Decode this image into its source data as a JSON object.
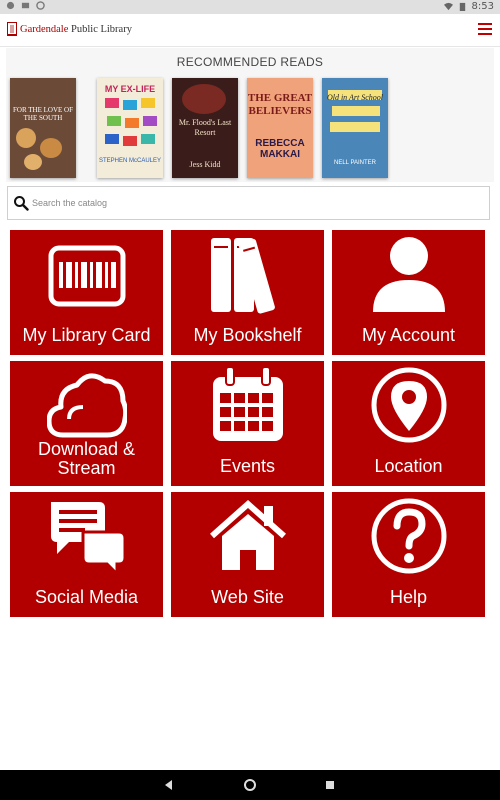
{
  "status_bar": {
    "time": "8:53"
  },
  "header": {
    "logo_first": "Gardendale",
    "logo_rest": " Public Library",
    "menu_icon": "hamburger-menu-icon"
  },
  "recommended": {
    "title": "RECOMMENDED READS",
    "books": [
      {
        "title": "FOR THE LOVE OF THE SOUTH",
        "author": "",
        "bg": "#7a5a45"
      },
      {
        "title": "MY EX-LIFE",
        "author": "STEPHEN McCAULEY",
        "bg": "#f3ecd8"
      },
      {
        "title": "Mr. Flood's Last Resort",
        "author": "Jess Kidd",
        "bg": "#3a1d1a"
      },
      {
        "title": "THE GREAT BELIEVERS",
        "author": "REBECCA MAKKAI",
        "bg": "#f0a37a"
      },
      {
        "title": "Old in Art School",
        "author": "NELL PAINTER",
        "bg": "#4a86b8"
      }
    ]
  },
  "search": {
    "placeholder": "Search the catalog"
  },
  "tiles": [
    {
      "label": "My Library Card",
      "icon": "library-card-icon"
    },
    {
      "label": "My Bookshelf",
      "icon": "bookshelf-icon"
    },
    {
      "label": "My Account",
      "icon": "account-icon"
    },
    {
      "label_line1": "Download &",
      "label_line2": "Stream",
      "icon": "cloud-icon"
    },
    {
      "label": "Events",
      "icon": "calendar-icon"
    },
    {
      "label": "Location",
      "icon": "location-pin-icon"
    },
    {
      "label": "Social Media",
      "icon": "chat-bubbles-icon"
    },
    {
      "label": "Web Site",
      "icon": "home-icon"
    },
    {
      "label": "Help",
      "icon": "question-icon"
    }
  ],
  "colors": {
    "tile": "#b20000",
    "accent": "#c00000"
  }
}
